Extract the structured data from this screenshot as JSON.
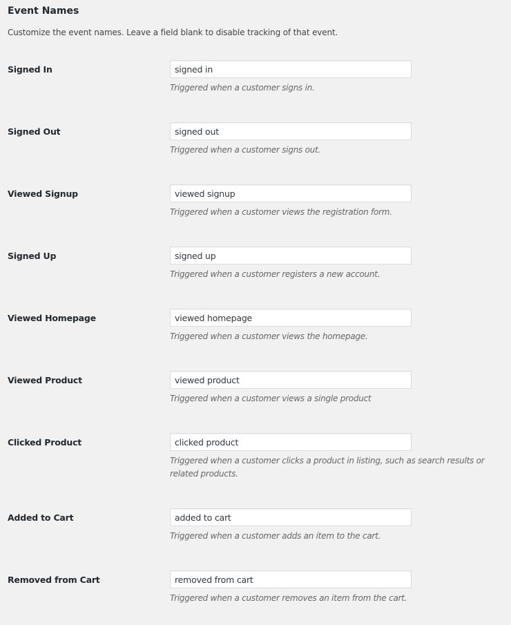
{
  "section": {
    "title": "Event Names",
    "intro": "Customize the event names. Leave a field blank to disable tracking of that event."
  },
  "fields": [
    {
      "label": "Signed In",
      "value": "signed in",
      "description": "Triggered when a customer signs in."
    },
    {
      "label": "Signed Out",
      "value": "signed out",
      "description": "Triggered when a customer signs out."
    },
    {
      "label": "Viewed Signup",
      "value": "viewed signup",
      "description": "Triggered when a customer views the registration form."
    },
    {
      "label": "Signed Up",
      "value": "signed up",
      "description": "Triggered when a customer registers a new account."
    },
    {
      "label": "Viewed Homepage",
      "value": "viewed homepage",
      "description": "Triggered when a customer views the homepage."
    },
    {
      "label": "Viewed Product",
      "value": "viewed product",
      "description": "Triggered when a customer views a single product"
    },
    {
      "label": "Clicked Product",
      "value": "clicked product",
      "description": "Triggered when a customer clicks a product in listing, such as search results or related products."
    },
    {
      "label": "Added to Cart",
      "value": "added to cart",
      "description": "Triggered when a customer adds an item to the cart."
    },
    {
      "label": "Removed from Cart",
      "value": "removed from cart",
      "description": "Triggered when a customer removes an item from the cart."
    }
  ]
}
